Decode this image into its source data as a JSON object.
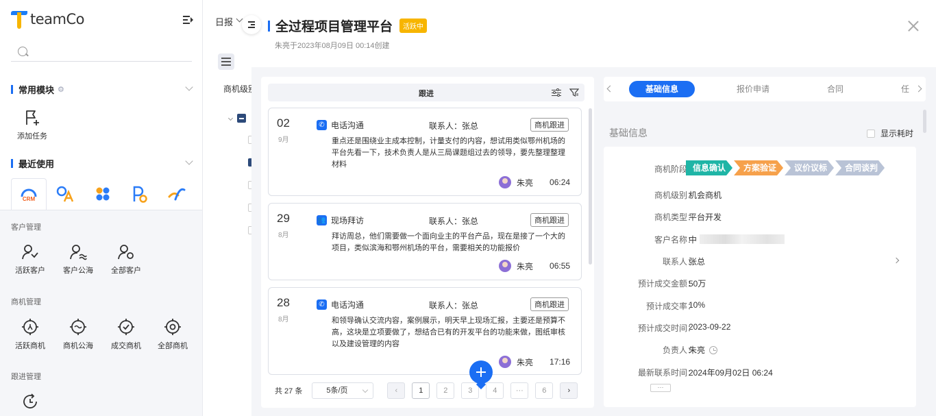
{
  "brand": {
    "name": "teamCo"
  },
  "sidebar": {
    "search_placeholder": "",
    "common_modules": "常用模块",
    "add_task": "添加任务",
    "recent": "最近使用",
    "apps": [
      "CRM",
      "OA",
      "apps",
      "PO",
      "link"
    ],
    "customer_group": "客户管理",
    "customer_items": [
      "活跃客户",
      "客户公海",
      "全部客户"
    ],
    "opportunity_group": "商机管理",
    "opportunity_items": [
      "活跃商机",
      "商机公海",
      "成交商机",
      "全部商机"
    ],
    "followup_group": "跟进管理"
  },
  "mid": {
    "report": "日报",
    "level_label": "商机级别"
  },
  "drawer": {
    "title": "全过程项目管理平台",
    "badge": "活跃中",
    "subtitle": "朱亮于2023年08月09日 00:14创建",
    "follow_header": "跟进",
    "records": [
      {
        "day": "02",
        "month": "9月",
        "type": "电话沟通",
        "contact": "联系人：张总",
        "tag": "商机跟进",
        "text": "重点还是围绕业主成本控制，计量支付的内容，想试用类似鄂州机场的平台先看一下，技术负责人是从三局课题组过去的领导，要先整理整理材料",
        "user": "朱亮",
        "time": "06:24"
      },
      {
        "day": "29",
        "month": "8月",
        "type": "现场拜访",
        "contact": "联系人：张总",
        "tag": "商机跟进",
        "text": "拜访周总，他们需要做一个面向业主的平台产品，现在是接了一个大的项目，类似滨海和鄂州机场的平台，需要相关的功能报价",
        "user": "朱亮",
        "time": "06:55"
      },
      {
        "day": "28",
        "month": "8月",
        "type": "电话沟通",
        "contact": "联系人：张总",
        "tag": "商机跟进",
        "text": "和领导确认交流内容，案例展示，明天早上现场汇报，主要还是预算不高，这块是立项要做了，想结合已有的开发平台的功能来做，图纸审核以及建设管理的内容",
        "user": "朱亮",
        "time": "17:16"
      }
    ],
    "pager": {
      "total": "共 27 条",
      "size": "5条/页",
      "pages": [
        "1",
        "2",
        "3",
        "4",
        "···",
        "6"
      ]
    },
    "tabs": [
      "基础信息",
      "报价申请",
      "合同",
      "任"
    ],
    "info_title": "基础信息",
    "show_time": "显示耗时",
    "stages": [
      {
        "label": "信息确认",
        "color": "#1fb5a6"
      },
      {
        "label": "方案验证",
        "color": "#f6a14b"
      },
      {
        "label": "议价议标",
        "color": "#b9c3d6"
      },
      {
        "label": "合同谈判",
        "color": "#b9c3d6"
      }
    ],
    "fields": [
      {
        "k": "商机阶段：",
        "v": ""
      },
      {
        "k": "商机级别：",
        "v": "机会商机"
      },
      {
        "k": "商机类型：",
        "v": "平台开发"
      },
      {
        "k": "客户名称：",
        "v": "中"
      },
      {
        "k": "联系人：",
        "v": "张总"
      },
      {
        "k": "预计成交金额：",
        "v": "50万"
      },
      {
        "k": "预计成交率：",
        "v": "10%"
      },
      {
        "k": "预计成交时间：",
        "v": "2023-09-22"
      },
      {
        "k": "负责人：",
        "v": "朱亮"
      },
      {
        "k": "最新联系时间：",
        "v": "2024年09月02日 06:24"
      }
    ],
    "more": "···"
  }
}
